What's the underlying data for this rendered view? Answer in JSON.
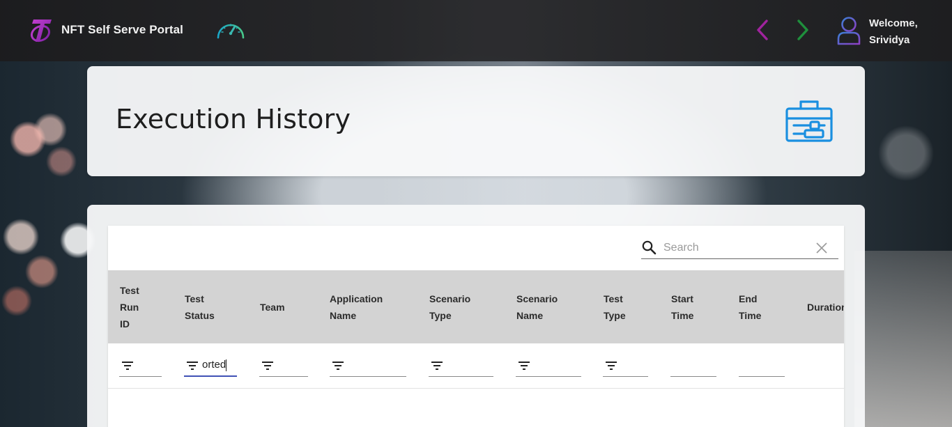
{
  "header": {
    "portal_title": "NFT Self Serve Portal",
    "welcome_line1": "Welcome,",
    "welcome_line2": "Srividya",
    "icons": [
      "telstra-logo-icon",
      "speedometer-icon",
      "chevron-left-icon",
      "chevron-right-icon",
      "user-icon"
    ]
  },
  "page": {
    "title": "Execution History",
    "title_icon": "toolbox-icon"
  },
  "search": {
    "placeholder": "Search",
    "value": ""
  },
  "table": {
    "columns": [
      {
        "id": "test_run_id",
        "lines": [
          "Test",
          "Run",
          "ID"
        ]
      },
      {
        "id": "test_status",
        "lines": [
          "Test",
          "Status"
        ]
      },
      {
        "id": "team",
        "lines": [
          "Team"
        ]
      },
      {
        "id": "application_name",
        "lines": [
          "Application",
          "Name"
        ]
      },
      {
        "id": "scenario_type",
        "lines": [
          "Scenario",
          "Type"
        ]
      },
      {
        "id": "scenario_name",
        "lines": [
          "Scenario",
          "Name"
        ]
      },
      {
        "id": "test_type",
        "lines": [
          "Test",
          "Type"
        ]
      },
      {
        "id": "start_time",
        "lines": [
          "Start",
          "Time"
        ]
      },
      {
        "id": "end_time",
        "lines": [
          "End",
          "Time"
        ]
      },
      {
        "id": "duration",
        "lines": [
          "Duration"
        ]
      }
    ],
    "filters": {
      "test_run_id": "",
      "test_status": "orted",
      "team": "",
      "application_name": "",
      "scenario_type": "",
      "scenario_name": "",
      "test_type": "",
      "start_time": "",
      "end_time": ""
    },
    "rows": []
  },
  "colors": {
    "accent_purple": "#9b1fa0",
    "accent_green": "#1e8f3a",
    "icon_blue": "#1a8fe0",
    "filter_active": "#3f51b5",
    "header_row_bg": "#d3d3d3"
  }
}
